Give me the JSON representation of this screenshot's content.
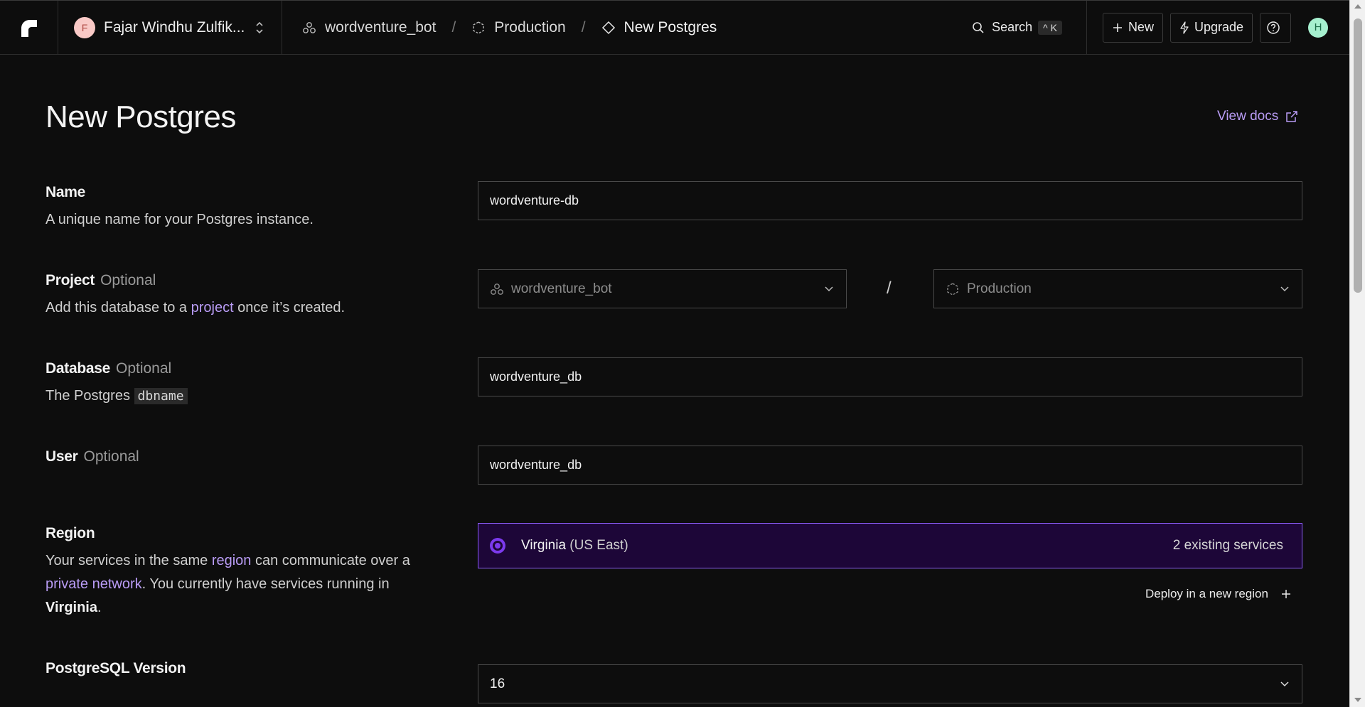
{
  "topbar": {
    "workspace": {
      "initial": "F",
      "name": "Fajar Windhu Zulfik..."
    },
    "breadcrumbs": [
      {
        "label": "wordventure_bot",
        "icon": "project-icon"
      },
      {
        "label": "Production",
        "icon": "environment-icon"
      },
      {
        "label": "New Postgres",
        "icon": "postgres-diamond-icon"
      }
    ],
    "breadcrumb_separator": "/",
    "search_label": "Search",
    "search_shortcut": "^ K",
    "new_label": "New",
    "upgrade_label": "Upgrade",
    "user_initial": "H"
  },
  "page": {
    "title": "New Postgres",
    "view_docs": "View docs"
  },
  "form": {
    "name": {
      "label": "Name",
      "description": "A unique name for your Postgres instance.",
      "value": "wordventure-db"
    },
    "project": {
      "label": "Project",
      "optional": "Optional",
      "desc_before": "Add this database to a ",
      "desc_link": "project",
      "desc_after": " once it’s created.",
      "project_value": "wordventure_bot",
      "separator": "/",
      "environment_value": "Production"
    },
    "database": {
      "label": "Database",
      "optional": "Optional",
      "desc_before": "The Postgres ",
      "desc_code": "dbname",
      "value": "wordventure_db"
    },
    "user": {
      "label": "User",
      "optional": "Optional",
      "value": "wordventure_db"
    },
    "region": {
      "label": "Region",
      "desc_1": "Your services in the same ",
      "desc_link1": "region",
      "desc_2": " can communicate over a",
      "desc_link2": "private network",
      "desc_3": ". You currently have services running in",
      "desc_bold": "Virginia",
      "desc_4": ".",
      "selected_name": "Virginia",
      "selected_sub": " (US East)",
      "selected_count": "2 existing services",
      "deploy_new": "Deploy in a new region"
    },
    "version": {
      "label": "PostgreSQL Version",
      "value": "16"
    }
  },
  "colors": {
    "accent": "#b99cf5",
    "selected_bg": "#1d0638",
    "selected_border": "#8b5cf6",
    "background": "#0d0d0d"
  }
}
